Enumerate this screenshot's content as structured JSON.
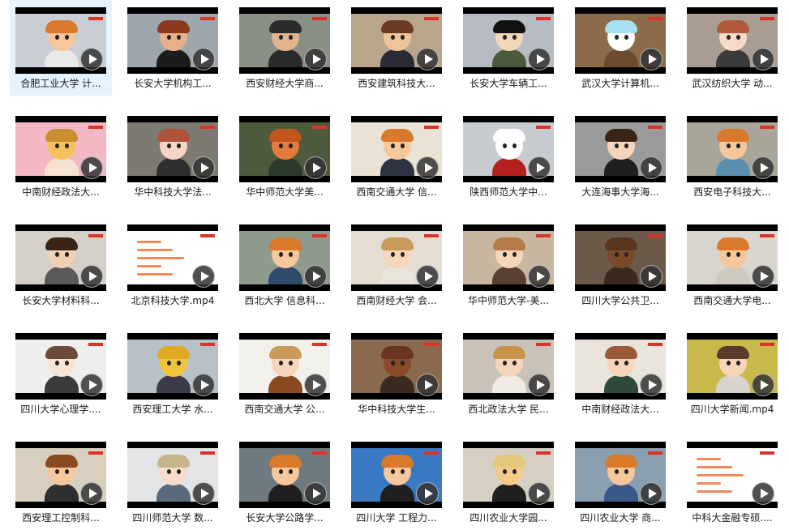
{
  "files": [
    {
      "label": "合肥工业大学 计...",
      "selected": true,
      "bg": "#c9cdd4",
      "skin": "#f6c79a",
      "hair": "#d9792b",
      "shirt": "#e9e9e9"
    },
    {
      "label": "长安大学机构工...",
      "selected": false,
      "bg": "#9ea5ad",
      "skin": "#e8b08a",
      "hair": "#8b3a1e",
      "shirt": "#1c1c1c"
    },
    {
      "label": "西安财经大学商...",
      "selected": false,
      "bg": "#8a8f85",
      "skin": "#e2b48e",
      "hair": "#2b2b2b",
      "shirt": "#2a2a2a"
    },
    {
      "label": "西安建筑科技大...",
      "selected": false,
      "bg": "#b8a58c",
      "skin": "#f0c49b",
      "hair": "#6a3b22",
      "shirt": "#2b2b35"
    },
    {
      "label": "长安大学车辆工...",
      "selected": false,
      "bg": "#b7bcc3",
      "skin": "#f1d7b8",
      "hair": "#111111",
      "shirt": "#4a5a3a"
    },
    {
      "label": "武汉大学计算机...",
      "selected": false,
      "bg": "#8b6b4a",
      "skin": "#ffffff",
      "hair": "#a6e0f2",
      "shirt": "#6b4c2f"
    },
    {
      "label": "武汉纺织大学 动...",
      "selected": false,
      "bg": "#a89c93",
      "skin": "#f7d9c8",
      "hair": "#b05a3a",
      "shirt": "#3b3b3b"
    },
    {
      "label": "中南财经政法大...",
      "selected": false,
      "bg": "#f2b8c4",
      "skin": "#f4c15a",
      "hair": "#c98f2f",
      "shirt": "#f5e2d0"
    },
    {
      "label": "华中科技大学法...",
      "selected": false,
      "bg": "#7d7a72",
      "skin": "#f6d5c4",
      "hair": "#b0513a",
      "shirt": "#2f2f2f"
    },
    {
      "label": "华中师范大学美...",
      "selected": false,
      "bg": "#4d5a3b",
      "skin": "#e27b3a",
      "hair": "#c4541f",
      "shirt": "#2b3a2a"
    },
    {
      "label": "西南交通大学 信...",
      "selected": false,
      "bg": "#e9e2d5",
      "skin": "#f6c79a",
      "hair": "#d9792b",
      "shirt": "#2d3340"
    },
    {
      "label": "陕西师范大学中...",
      "selected": false,
      "bg": "#c8ccd0",
      "skin": "#ffffff",
      "hair": "#ffffff",
      "shirt": "#b3201d"
    },
    {
      "label": "大连海事大学海...",
      "selected": false,
      "bg": "#9a9a9a",
      "skin": "#f6d5bb",
      "hair": "#3a2416",
      "shirt": "#1f1f1f"
    },
    {
      "label": "西安电子科技大...",
      "selected": false,
      "bg": "#a8a69a",
      "skin": "#f6c79a",
      "hair": "#d9792b",
      "shirt": "#5b8fb0"
    },
    {
      "label": "长安大学材料科...",
      "selected": false,
      "bg": "#d4d0c8",
      "skin": "#f1d0b4",
      "hair": "#3a2416",
      "shirt": "#5a5a5a"
    },
    {
      "label": "北京科技大学.mp4",
      "selected": false,
      "bg": "#ffffff",
      "skin": "#ffffff",
      "hair": "#ffffff",
      "shirt": "#ffffff"
    },
    {
      "label": "西北大学 信息科...",
      "selected": false,
      "bg": "#8e9a8c",
      "skin": "#f6c79a",
      "hair": "#d9792b",
      "shirt": "#2f4a6a"
    },
    {
      "label": "西南财经大学 会...",
      "selected": false,
      "bg": "#e3ddd2",
      "skin": "#f6d5bb",
      "hair": "#c99a5a",
      "shirt": "#e8e4dc"
    },
    {
      "label": "华中师范大学-美...",
      "selected": false,
      "bg": "#c7b7a1",
      "skin": "#f6d5bb",
      "hair": "#b57a45",
      "shirt": "#5a4030"
    },
    {
      "label": "四川大学公共卫...",
      "selected": false,
      "bg": "#6b5a4a",
      "skin": "#7a4a2a",
      "hair": "#5a3520",
      "shirt": "#3a2a20"
    },
    {
      "label": "西南交通大学电...",
      "selected": false,
      "bg": "#d9d6cf",
      "skin": "#f6c79a",
      "hair": "#d9792b",
      "shirt": "#cfcac0"
    },
    {
      "label": "四川大学心理学....",
      "selected": false,
      "bg": "#eeeeee",
      "skin": "#f7e4d6",
      "hair": "#6a4a3a",
      "shirt": "#3a3a3a"
    },
    {
      "label": "西安理工大学 水...",
      "selected": false,
      "bg": "#b8c0c8",
      "skin": "#f2c43a",
      "hair": "#e0a720",
      "shirt": "#3a3a4a"
    },
    {
      "label": "西南交通大学 公...",
      "selected": false,
      "bg": "#f2f0ea",
      "skin": "#f6d5bb",
      "hair": "#c99a5a",
      "shirt": "#8a4a1f"
    },
    {
      "label": "华中科技大学生...",
      "selected": false,
      "bg": "#8a6a4f",
      "skin": "#8a4a2a",
      "hair": "#6a3520",
      "shirt": "#3a2a20"
    },
    {
      "label": "西北政法大学 民...",
      "selected": false,
      "bg": "#c8c2b8",
      "skin": "#f6d5bb",
      "hair": "#c9944a",
      "shirt": "#f0ece4"
    },
    {
      "label": "中南财经政法大...",
      "selected": false,
      "bg": "#e9e4dc",
      "skin": "#f6d5bb",
      "hair": "#9a5a3a",
      "shirt": "#2f4a3a"
    },
    {
      "label": "四川大学新闻.mp4",
      "selected": false,
      "bg": "#c7b94a",
      "skin": "#f6d5bb",
      "hair": "#5a3a2a",
      "shirt": "#d8d4cc"
    },
    {
      "label": "西安理工控制科...",
      "selected": false,
      "bg": "#d8cfbf",
      "skin": "#f6c79a",
      "hair": "#8a4a1f",
      "shirt": "#2f2f2f"
    },
    {
      "label": "四川师范大学 数...",
      "selected": false,
      "bg": "#e2e4e6",
      "skin": "#f7dccb",
      "hair": "#c7b48a",
      "shirt": "#5a6a7a"
    },
    {
      "label": "长安大学公路学...",
      "selected": false,
      "bg": "#6f7a80",
      "skin": "#f6c79a",
      "hair": "#d9792b",
      "shirt": "#1f1f1f"
    },
    {
      "label": "四川大学 工程力...",
      "selected": false,
      "bg": "#3a7ac4",
      "skin": "#f6c79a",
      "hair": "#d9792b",
      "shirt": "#1f1f1f"
    },
    {
      "label": "四川农业大学园...",
      "selected": false,
      "bg": "#d6d0c4",
      "skin": "#f4c98a",
      "hair": "#e6c87a",
      "shirt": "#1f1f1f"
    },
    {
      "label": "四川农业大学 商...",
      "selected": false,
      "bg": "#8aa0b0",
      "skin": "#f6c79a",
      "hair": "#d9792b",
      "shirt": "#3a5a8a"
    },
    {
      "label": "中科大金融专硕....",
      "selected": false,
      "bg": "#ffffff",
      "skin": "#ffffff",
      "hair": "#ffffff",
      "shirt": "#ffffff"
    }
  ]
}
